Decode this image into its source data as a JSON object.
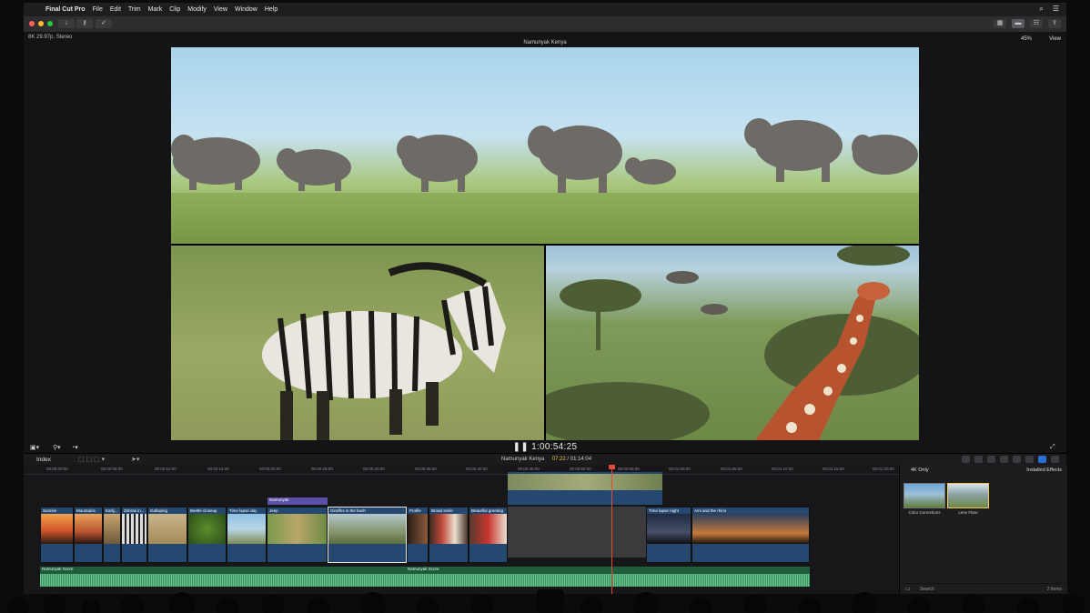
{
  "menubar": {
    "items": [
      "Final Cut Pro",
      "File",
      "Edit",
      "Trim",
      "Mark",
      "Clip",
      "Modify",
      "View",
      "Window",
      "Help"
    ]
  },
  "viewer": {
    "format": "8K 29.97p, Stereo",
    "clip_title": "Namunyak Kenya",
    "zoom": "45%",
    "view_label": "View",
    "timecode": "1:00:54:25"
  },
  "timeline": {
    "index_label": "Index",
    "project_name": "Namunyak Kenya",
    "current": "07:22",
    "duration": "01:14:04",
    "ruler": [
      "00:00:00:00",
      "00:00:05:00",
      "00:00:10:00",
      "00:00:15:00",
      "00:00:20:00",
      "00:00:25:00",
      "00:00:30:00",
      "00:00:35:00",
      "00:00:40:00",
      "00:00:45:00",
      "00:00:50:00",
      "00:00:55:00",
      "00:01:00:00",
      "00:01:05:00",
      "00:01:10:00",
      "00:01:15:00",
      "00:01:20:00"
    ],
    "title_clip": "Namunyak",
    "clips": [
      "Sunrise",
      "Mountains",
      "Early...",
      "Zebras in...",
      "Galloping",
      "Beetle closeup",
      "Time lapse day",
      "Jeep",
      "Giraffes in the bush",
      "Profile",
      "Broad smile",
      "Beautiful greeting",
      "Time lapse night",
      "Ami and the rhino"
    ],
    "audio": [
      "Namunyak Score",
      "Namunyak Score"
    ]
  },
  "effects": {
    "filter": "4K Only",
    "category": "Installed Effects",
    "items": [
      "Color Corrections",
      "Lens Flare"
    ],
    "search_placeholder": "Search",
    "count": "2 items"
  },
  "colors": {
    "clip_blue": "#24486f",
    "audio_green": "#1f5c3c",
    "playhead": "#e24b3a",
    "title_purple": "#5b4fa6"
  }
}
